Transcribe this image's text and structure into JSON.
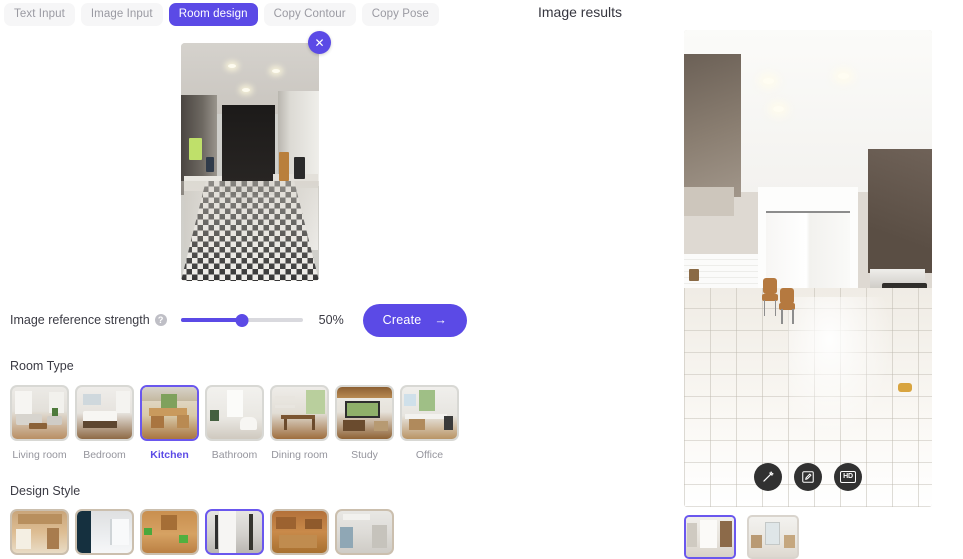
{
  "tabs": [
    {
      "label": "Text Input",
      "active": false
    },
    {
      "label": "Image Input",
      "active": false
    },
    {
      "label": "Room design",
      "active": true
    },
    {
      "label": "Copy Contour",
      "active": false
    },
    {
      "label": "Copy Pose",
      "active": false
    }
  ],
  "upload": {
    "close_label": "✕",
    "alt": "uploaded galley kitchen photo with patterned tile floor"
  },
  "strength": {
    "label": "Image reference strength",
    "help_icon": "help-circle-icon",
    "help_glyph": "?",
    "value_text": "50%",
    "percent": 50
  },
  "create": {
    "label": "Create",
    "arrow": "→"
  },
  "room_type": {
    "title": "Room Type",
    "items": [
      {
        "label": "Living room",
        "selected": false
      },
      {
        "label": "Bedroom",
        "selected": false
      },
      {
        "label": "Kitchen",
        "selected": true
      },
      {
        "label": "Bathroom",
        "selected": false
      },
      {
        "label": "Dining room",
        "selected": false
      },
      {
        "label": "Study",
        "selected": false
      },
      {
        "label": "Office",
        "selected": false
      }
    ]
  },
  "design_style": {
    "title": "Design Style",
    "items": [
      {
        "selected": false
      },
      {
        "selected": false
      },
      {
        "selected": false
      },
      {
        "selected": true
      },
      {
        "selected": false
      },
      {
        "selected": false
      }
    ]
  },
  "results": {
    "title": "Image results",
    "actions": [
      {
        "name": "magic-wand-icon",
        "glyph": "✦"
      },
      {
        "name": "edit-icon",
        "glyph": "✎"
      },
      {
        "name": "hd-icon",
        "glyph": "HD"
      }
    ],
    "thumbs": [
      {
        "selected": true
      },
      {
        "selected": false
      }
    ]
  },
  "colors": {
    "accent": "#5b4ae6",
    "accent_border": "#6a57ee",
    "tab_inactive_bg": "#f6f6f7",
    "tab_inactive_text": "#9a9aa2",
    "text_primary": "#3b3b44",
    "text_muted": "#95959d",
    "action_btn_bg": "#313131"
  }
}
